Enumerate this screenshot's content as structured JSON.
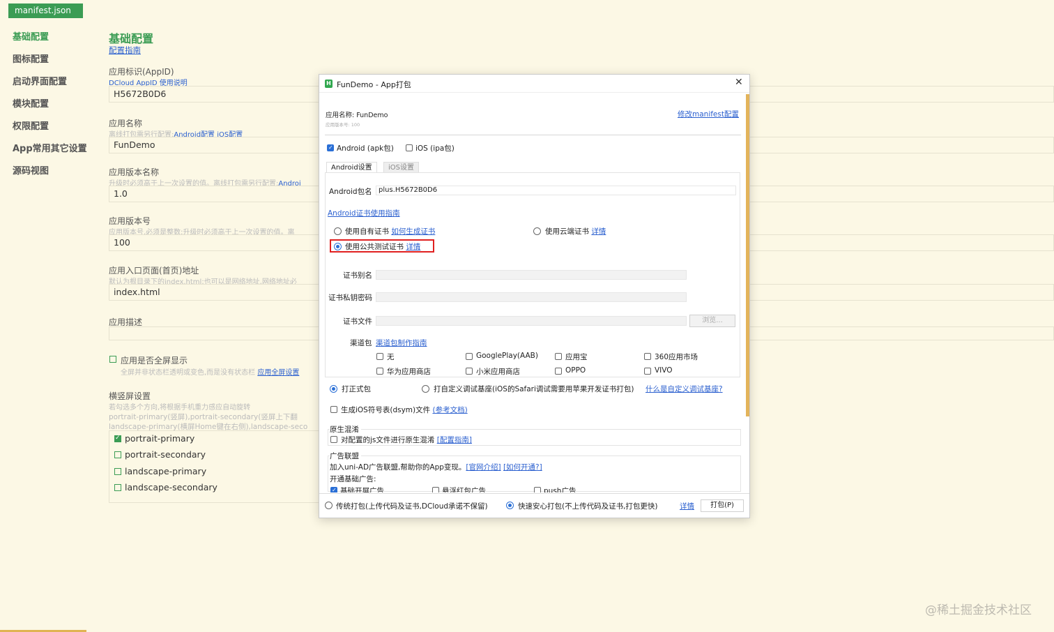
{
  "file_tab": "manifest.json",
  "sidebar": {
    "items": [
      {
        "label": "基础配置",
        "active": true
      },
      {
        "label": "图标配置"
      },
      {
        "label": "启动界面配置"
      },
      {
        "label": "模块配置"
      },
      {
        "label": "权限配置"
      },
      {
        "label": "App常用其它设置"
      },
      {
        "label": "源码视图"
      }
    ]
  },
  "main": {
    "title": "基础配置",
    "guide_link": "配置指南",
    "appid": {
      "label": "应用标识(AppID)",
      "hint_link": "DCloud AppID 使用说明",
      "value": "H5672B0D6"
    },
    "appname": {
      "label": "应用名称",
      "hint": "离线打包需另行配置:",
      "hint_link1": "Android配置",
      "hint_link2": "iOS配置",
      "value": "FunDemo"
    },
    "version_name": {
      "label": "应用版本名称",
      "hint": "升级时必须高于上一次设置的值。离线打包需另行配置:",
      "hint_link": "Androi",
      "value": "1.0"
    },
    "version_code": {
      "label": "应用版本号",
      "hint": "应用版本号,必须是整数;升级时必须高于上一次设置的值。离",
      "value": "100"
    },
    "entry": {
      "label": "应用入口页面(首页)地址",
      "hint": "默认为根目录下的index.html;也可以是网络地址,网络地址必",
      "value": "index.html"
    },
    "description": {
      "label": "应用描述",
      "value": ""
    },
    "fullscreen": {
      "label": "应用是否全屏显示",
      "hint": "全屏并非状态栏透明或变色,而是没有状态栏",
      "hint_link": "应用全屏设置"
    },
    "orientation": {
      "label": "横竖屏设置",
      "hint1": "若勾选多个方向,将根据手机重力感应自动旋转",
      "hint2": "portrait-primary(竖屏),portrait-secondary(竖屏上下翻",
      "hint3": "landscape-primary(横屏Home键在右侧),landscape-seco",
      "options": [
        {
          "label": "portrait-primary",
          "checked": true
        },
        {
          "label": "portrait-secondary",
          "checked": false
        },
        {
          "label": "landscape-primary",
          "checked": false
        },
        {
          "label": "landscape-secondary",
          "checked": false
        }
      ]
    }
  },
  "watermark": "@稀土掘金技术社区",
  "dialog": {
    "title": "FunDemo - App打包",
    "app_name_line": "应用名称: FunDemo",
    "version_line": "应用版本号: 100",
    "modify_link": "修改manifest配置",
    "platforms": [
      {
        "label": "Android (apk包)",
        "checked": true
      },
      {
        "label": "iOS (ipa包)",
        "checked": false
      }
    ],
    "tabs": [
      {
        "label": "Android设置",
        "active": true
      },
      {
        "label": "iOS设置",
        "active": false
      }
    ],
    "package_label": "Android包名",
    "package_value": "plus.H5672B0D6",
    "cert_guide_link": "Android证书使用指南",
    "cert_options": {
      "own": {
        "label": "使用自有证书",
        "link": "如何生成证书",
        "selected": false
      },
      "cloud": {
        "label": "使用云端证书",
        "link": "详情",
        "selected": false
      },
      "public": {
        "label": "使用公共测试证书",
        "link": "详情",
        "selected": true
      }
    },
    "cert_alias_label": "证书别名",
    "cert_pwd_label": "证书私钥密码",
    "cert_file_label": "证书文件",
    "browse_label": "浏览...",
    "channel_label": "渠道包",
    "channel_link": "渠道包制作指南",
    "channels": [
      {
        "label": "无",
        "checked": false
      },
      {
        "label": "GooglePlay(AAB)",
        "checked": false
      },
      {
        "label": "应用宝",
        "checked": false
      },
      {
        "label": "360应用市场",
        "checked": false
      },
      {
        "label": "华为应用商店",
        "checked": false
      },
      {
        "label": "小米应用商店",
        "checked": false
      },
      {
        "label": "OPPO",
        "checked": false
      },
      {
        "label": "VIVO",
        "checked": false
      }
    ],
    "build_type": {
      "release": {
        "label": "打正式包",
        "selected": true
      },
      "custom": {
        "label": "打自定义调试基座(iOS的Safari调试需要用苹果开发证书打包)",
        "selected": false
      },
      "custom_link": "什么是自定义调试基座?"
    },
    "dsym": {
      "label": "生成iOS符号表(dsym)文件",
      "link": "(参考文档)",
      "checked": false
    },
    "native_obfuscation": {
      "title": "原生混淆",
      "label": "对配置的js文件进行原生混淆",
      "link": "[配置指南]",
      "checked": false
    },
    "ad": {
      "title": "广告联盟",
      "desc": "加入uni-AD广告联盟,帮助你的App变现。",
      "link1": "[官网介绍]",
      "link2": "[如何开通?]",
      "basic_label": "开通基础广告:",
      "options": [
        {
          "label": "基础开屏广告",
          "checked": true
        },
        {
          "label": "悬浮红包广告",
          "checked": false
        },
        {
          "label": "push广告",
          "checked": false
        }
      ]
    },
    "footer": {
      "traditional": {
        "label": "传统打包(上传代码及证书,DCloud承诺不保留)",
        "selected": false
      },
      "fast": {
        "label": "快速安心打包(不上传代码及证书,打包更快)",
        "selected": true
      },
      "detail_link": "详情",
      "pack_button": "打包(P)"
    }
  }
}
